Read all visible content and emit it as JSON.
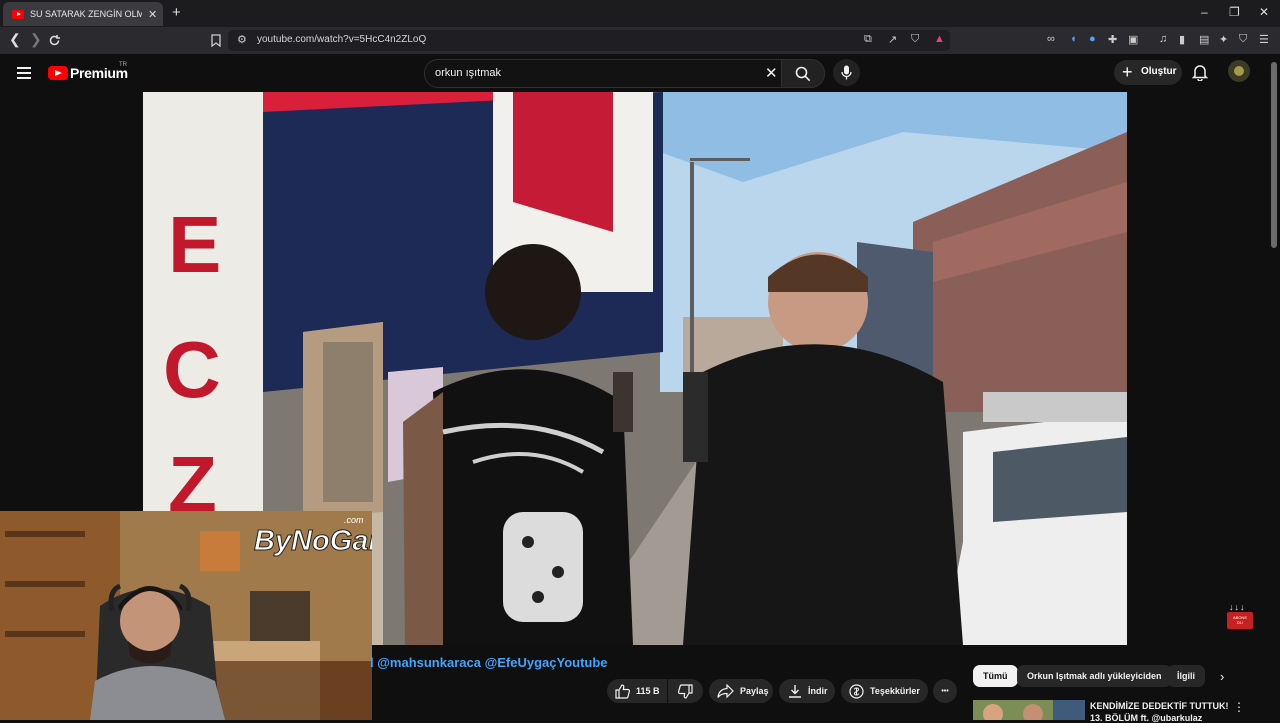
{
  "browser": {
    "tab_title": "SU SATARAK ZENGİN OLMAK! | M",
    "url": "youtube.com/watch?v=5HcC4n2ZLoQ",
    "new_tab_symbol": "+",
    "minimize": "–",
    "restore": "❐",
    "close": "✕"
  },
  "youtube": {
    "logo_text": "Premium",
    "region": "TR",
    "search_value": "orkun ışıtmak",
    "create_label": "Oluştur"
  },
  "video": {
    "overlay_brand": "ByNoGame",
    "overlay_brand_suffix": ".com",
    "watermark_arrows": "↓↓↓",
    "watermark_text": "ABONE OL!",
    "shop_letters": "ECZ"
  },
  "description": {
    "mentions": "l @mahsunkaraca @EfeUygaçYoutube"
  },
  "actions": {
    "like_count": "115 B",
    "share_label": "Paylaş",
    "download_label": "İndir",
    "thanks_label": "Teşekkürler",
    "more_symbol": "•••"
  },
  "related_filters": [
    "Tümü",
    "Orkun Işıtmak adlı yükleyiciden",
    "İlgili"
  ],
  "recommendation": {
    "title": "KENDİMİZE DEDEKTİF TUTTUK!",
    "subtitle": "13. BÖLÜM ft. @ubarkulaz"
  },
  "colors": {
    "brand_red": "#ff0000",
    "link_blue": "#3ea6ff",
    "background": "#0f0f0f"
  }
}
